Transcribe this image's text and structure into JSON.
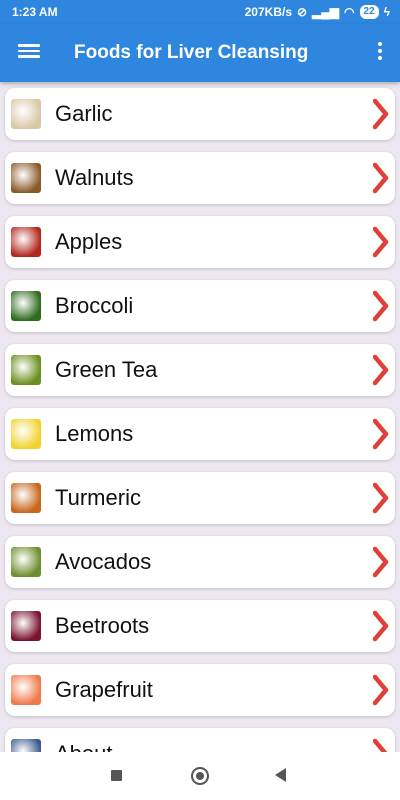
{
  "status_bar": {
    "time": "1:23 AM",
    "speed": "207KB/s",
    "battery": "22"
  },
  "app_bar": {
    "title": "Foods for Liver Cleansing",
    "menu_icon": "hamburger-icon",
    "more_icon": "more-vert-icon"
  },
  "items": [
    {
      "label": "Garlic",
      "icon": "garlic-icon",
      "color": "#D9C7A6"
    },
    {
      "label": "Walnuts",
      "icon": "walnuts-icon",
      "color": "#8B5A2B"
    },
    {
      "label": "Apples",
      "icon": "apples-icon",
      "color": "#B3261E"
    },
    {
      "label": "Broccoli",
      "icon": "broccoli-icon",
      "color": "#2F6B1F"
    },
    {
      "label": "Green Tea",
      "icon": "green-tea-icon",
      "color": "#6A8F1E"
    },
    {
      "label": "Lemons",
      "icon": "lemons-icon",
      "color": "#F2D22E"
    },
    {
      "label": "Turmeric",
      "icon": "turmeric-icon",
      "color": "#C8661C"
    },
    {
      "label": "Avocados",
      "icon": "avocados-icon",
      "color": "#6C8E2E"
    },
    {
      "label": "Beetroots",
      "icon": "beetroots-icon",
      "color": "#7A1230"
    },
    {
      "label": "Grapefruit",
      "icon": "grapefruit-icon",
      "color": "#F07A4A"
    },
    {
      "label": "About",
      "icon": "about-icon",
      "color": "#3A5A8C"
    }
  ],
  "colors": {
    "primary": "#2E86DE",
    "chevron": "#E0403A",
    "background": "#ECE7F1"
  }
}
